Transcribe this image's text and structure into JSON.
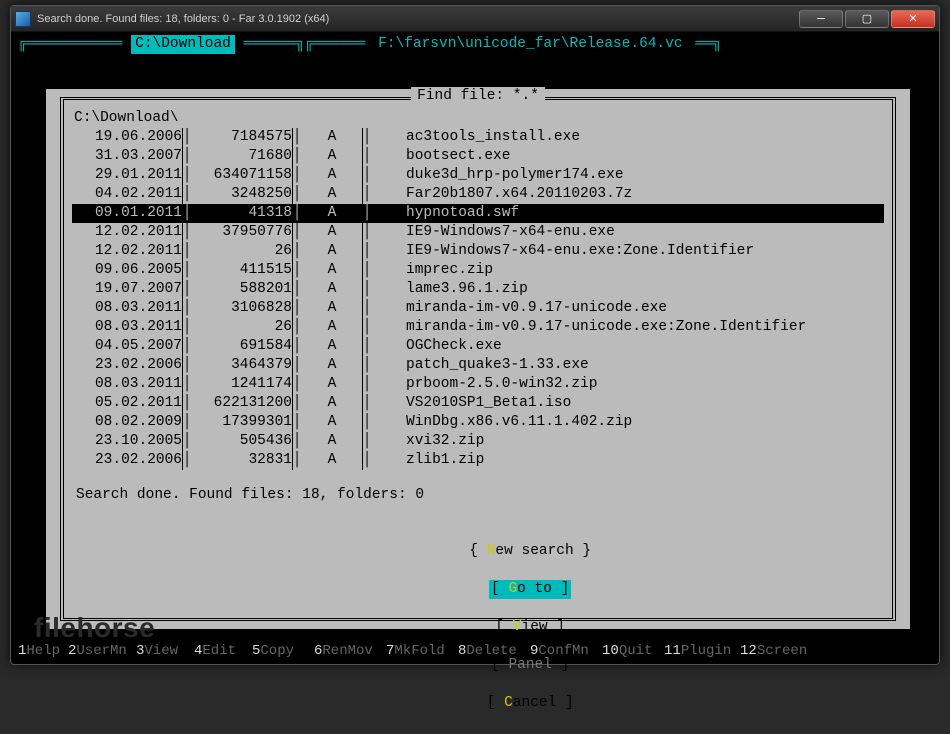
{
  "titlebar": {
    "text": "Search done. Found files: 18, folders: 0 - Far 3.0.1902 (x64)"
  },
  "panels": {
    "left_path": "C:\\Download",
    "right_path": "F:\\farsvn\\unicode_far\\Release.64.vc"
  },
  "dialog": {
    "title": " Find file: *.* ",
    "path": "C:\\Download\\",
    "selected_index": 4,
    "files": [
      {
        "date": "19.06.2006",
        "size": "7184575",
        "attr": "A",
        "name": "ac3tools_install.exe"
      },
      {
        "date": "31.03.2007",
        "size": "71680",
        "attr": "A",
        "name": "bootsect.exe"
      },
      {
        "date": "29.01.2011",
        "size": "634071158",
        "attr": "A",
        "name": "duke3d_hrp-polymer174.exe"
      },
      {
        "date": "04.02.2011",
        "size": "3248250",
        "attr": "A",
        "name": "Far20b1807.x64.20110203.7z"
      },
      {
        "date": "09.01.2011",
        "size": "41318",
        "attr": "A",
        "name": "hypnotoad.swf"
      },
      {
        "date": "12.02.2011",
        "size": "37950776",
        "attr": "A",
        "name": "IE9-Windows7-x64-enu.exe"
      },
      {
        "date": "12.02.2011",
        "size": "26",
        "attr": "A",
        "name": "IE9-Windows7-x64-enu.exe:Zone.Identifier"
      },
      {
        "date": "09.06.2005",
        "size": "411515",
        "attr": "A",
        "name": "imprec.zip"
      },
      {
        "date": "19.07.2007",
        "size": "588201",
        "attr": "A",
        "name": "lame3.96.1.zip"
      },
      {
        "date": "08.03.2011",
        "size": "3106828",
        "attr": "A",
        "name": "miranda-im-v0.9.17-unicode.exe"
      },
      {
        "date": "08.03.2011",
        "size": "26",
        "attr": "A",
        "name": "miranda-im-v0.9.17-unicode.exe:Zone.Identifier"
      },
      {
        "date": "04.05.2007",
        "size": "691584",
        "attr": "A",
        "name": "OGCheck.exe"
      },
      {
        "date": "23.02.2006",
        "size": "3464379",
        "attr": "A",
        "name": "patch_quake3-1.33.exe"
      },
      {
        "date": "08.03.2011",
        "size": "1241174",
        "attr": "A",
        "name": "prboom-2.5.0-win32.zip"
      },
      {
        "date": "05.02.2011",
        "size": "622131200",
        "attr": "A",
        "name": "VS2010SP1_Beta1.iso"
      },
      {
        "date": "08.02.2009",
        "size": "17399301",
        "attr": "A",
        "name": "WinDbg.x86.v6.11.1.402.zip"
      },
      {
        "date": "23.10.2005",
        "size": "505436",
        "attr": "A",
        "name": "xvi32.zip"
      },
      {
        "date": "23.02.2006",
        "size": "32831",
        "attr": "A",
        "name": "zlib1.zip"
      }
    ],
    "status": "Search done. Found files: 18, folders: 0",
    "buttons": {
      "new_search": {
        "label_pre": "N",
        "label_rest": "ew search"
      },
      "goto": {
        "label_pre": "G",
        "label_rest": "o to"
      },
      "view": {
        "label_pre": "V",
        "label_rest": "iew"
      },
      "panel": {
        "label_pre": "P",
        "label_rest": "anel"
      },
      "cancel": {
        "label_pre": "C",
        "label_rest": "ancel"
      }
    }
  },
  "keybar": [
    {
      "num": "1",
      "label": "Help"
    },
    {
      "num": "2",
      "label": "UserMn"
    },
    {
      "num": "3",
      "label": "View"
    },
    {
      "num": "4",
      "label": "Edit"
    },
    {
      "num": "5",
      "label": "Copy"
    },
    {
      "num": "6",
      "label": "RenMov"
    },
    {
      "num": "7",
      "label": "MkFold"
    },
    {
      "num": "8",
      "label": "Delete"
    },
    {
      "num": "9",
      "label": "ConfMn"
    },
    {
      "num": "10",
      "label": "Quit"
    },
    {
      "num": "11",
      "label": "Plugin"
    },
    {
      "num": "12",
      "label": "Screen"
    }
  ],
  "watermark": "filehorse"
}
